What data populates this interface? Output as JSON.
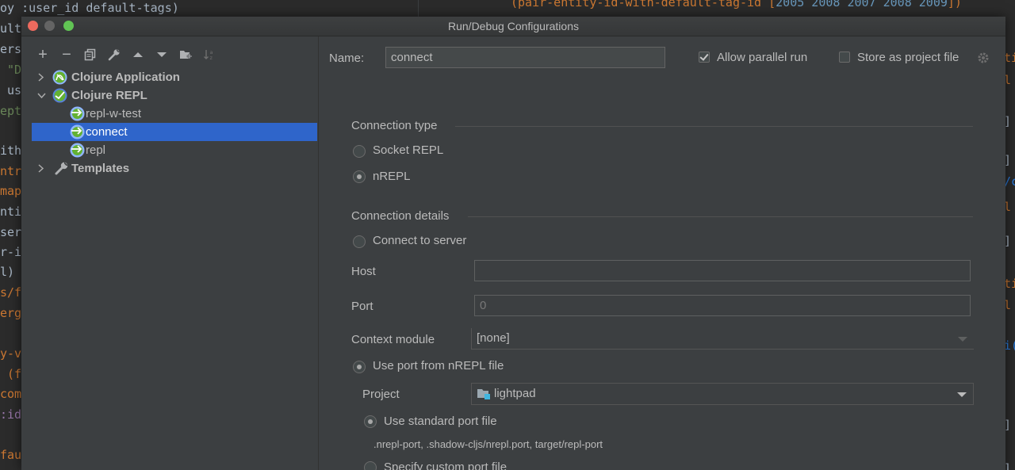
{
  "editor": {
    "left_lines": [
      {
        "text": "oy :user_id default-tags)",
        "color": "#a9b7c6"
      },
      {
        "text": "ult",
        "color": "#a9b7c6"
      },
      {
        "text": "ers",
        "color": "#a9b7c6"
      },
      {
        "text": " \"D",
        "color": "#6a8759"
      },
      {
        "text": " us",
        "color": "#a9b7c6"
      },
      {
        "text": "ept",
        "color": "#6a8759"
      },
      {
        "text": "ith",
        "color": "#a9b7c6"
      },
      {
        "text": "ntr",
        "color": "#cc7832"
      },
      {
        "text": "map",
        "color": "#cc7832"
      },
      {
        "text": "nti",
        "color": "#a9b7c6"
      },
      {
        "text": "ser",
        "color": "#a9b7c6"
      },
      {
        "text": "r-i",
        "color": "#a9b7c6"
      },
      {
        "text": "l)",
        "color": "#a9b7c6"
      },
      {
        "text": "s/f",
        "color": "#cc7832"
      },
      {
        "text": "erg",
        "color": "#cc7832"
      },
      {
        "text": "y-v",
        "color": "#cc7832"
      },
      {
        "text": " (f",
        "color": "#cc7832"
      },
      {
        "text": "com",
        "color": "#cc7832"
      },
      {
        "text": ":id",
        "color": "#9876aa"
      },
      {
        "text": "fau",
        "color": "#cc7832"
      }
    ],
    "right_line": {
      "prefix": "(pair-entity-id-with-default-tag-id [",
      "numbers": "2005 2008 2007 2008 2009",
      "suffix": "])"
    },
    "right_marks": [
      "ti",
      "l",
      "]",
      "]",
      "/c",
      "l",
      "]",
      "ti",
      "l",
      "i(",
      "]",
      "]"
    ]
  },
  "dialog": {
    "title": "Run/Debug Configurations",
    "toolbar": {
      "add": "+",
      "remove": "−",
      "copy_icon": "copy-icon",
      "wrench_icon": "wrench-icon",
      "up_icon": "arrow-up-icon",
      "down_icon": "arrow-down-icon",
      "folder_icon": "new-folder-icon",
      "sort_icon": "sort-icon"
    },
    "tree": [
      {
        "label": "Clojure Application",
        "bold": true,
        "level": 0,
        "expanded": false,
        "icon": "clojure-icon"
      },
      {
        "label": "Clojure REPL",
        "bold": true,
        "level": 0,
        "expanded": true,
        "icon": "clojure-repl-icon"
      },
      {
        "label": "repl-w-test",
        "bold": false,
        "level": 1,
        "icon": "clojure-repl-icon"
      },
      {
        "label": "connect",
        "bold": false,
        "level": 1,
        "icon": "clojure-repl-icon",
        "selected": true
      },
      {
        "label": "repl",
        "bold": false,
        "level": 1,
        "icon": "clojure-repl-icon"
      },
      {
        "label": "Templates",
        "bold": true,
        "level": 0,
        "expanded": false,
        "icon": "wrench-icon"
      }
    ],
    "form": {
      "name_label": "Name:",
      "name_value": "connect",
      "allow_parallel": {
        "label": "Allow parallel run",
        "checked": true
      },
      "store_project": {
        "label": "Store as project file",
        "checked": false
      },
      "connection_type": {
        "title": "Connection type",
        "options": [
          {
            "label": "Socket REPL",
            "selected": false
          },
          {
            "label": "nREPL",
            "selected": true
          }
        ]
      },
      "connection_details": {
        "title": "Connection details",
        "connect_server": {
          "label": "Connect to server",
          "selected": false
        },
        "host_label": "Host",
        "host_value": "",
        "port_label": "Port",
        "port_value": "0",
        "context_label": "Context module",
        "context_value": "[none]",
        "use_port_file": {
          "label": "Use port from nREPL file",
          "selected": true
        },
        "project_label": "Project",
        "project_value": "lightpad",
        "use_standard": {
          "label": "Use standard port file",
          "selected": true
        },
        "standard_hint": ".nrepl-port, .shadow-cljs/nrepl.port, target/repl-port",
        "custom": {
          "label": "Specify custom port file",
          "selected": false
        }
      }
    }
  }
}
